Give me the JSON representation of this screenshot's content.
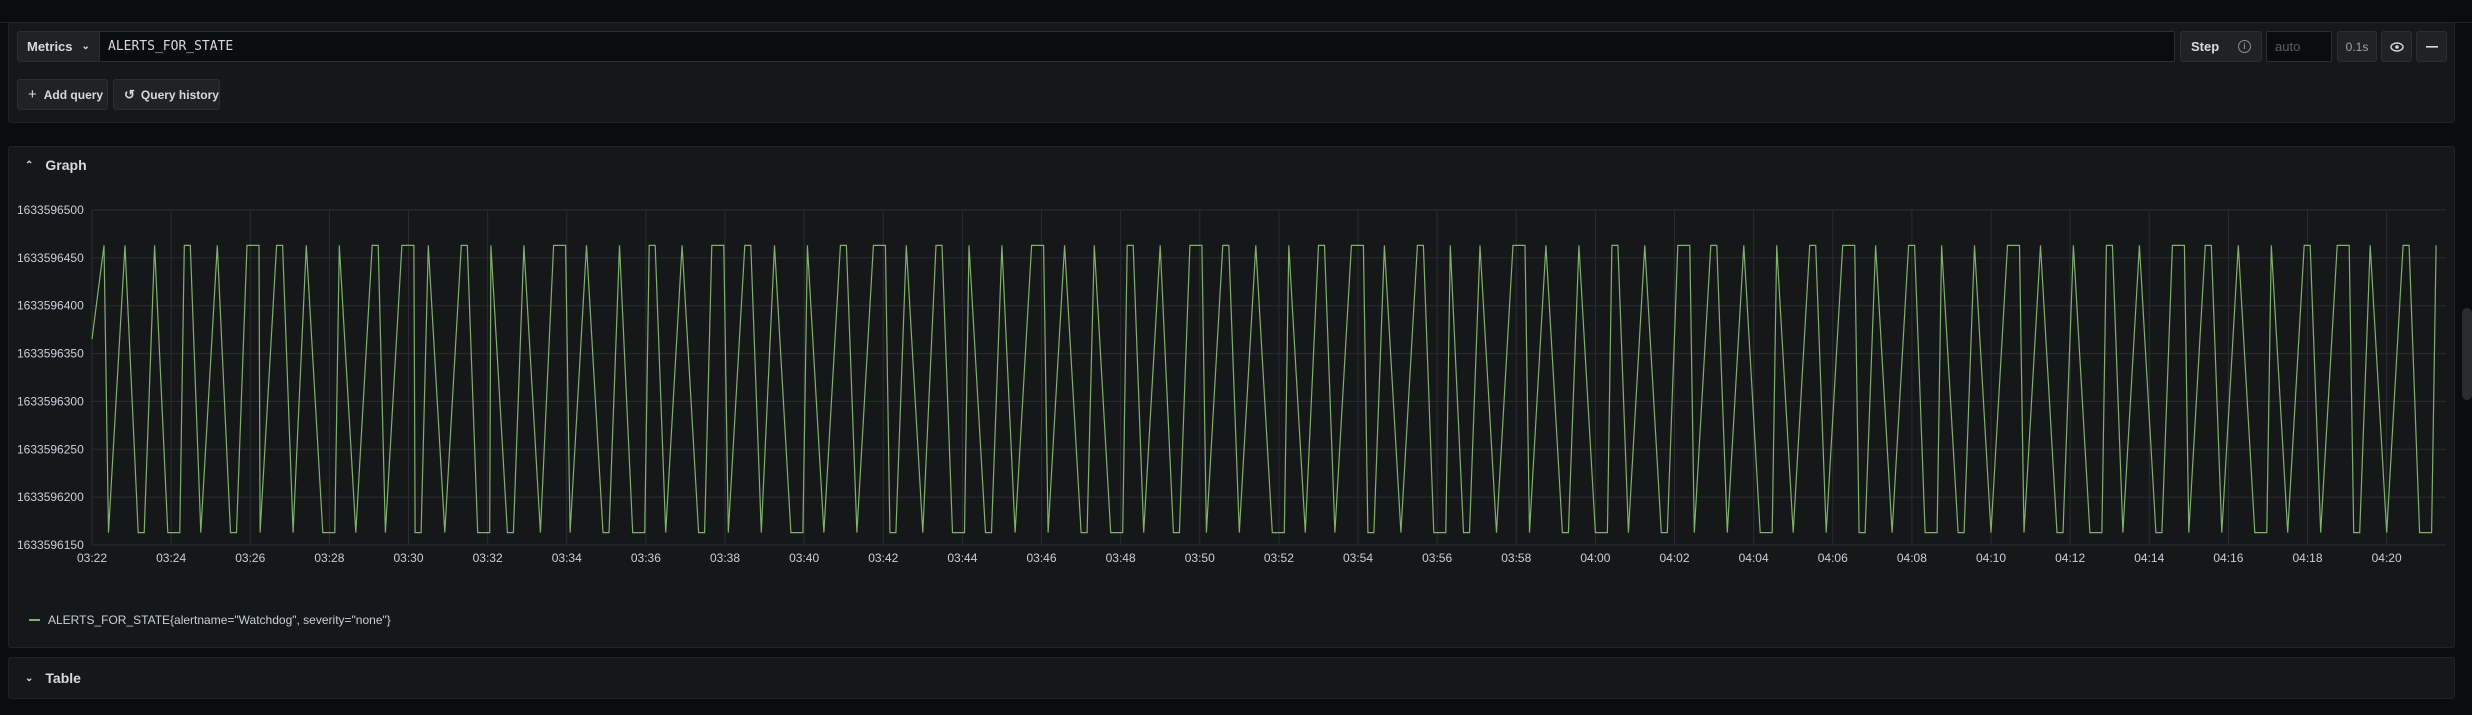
{
  "query_editor": {
    "metrics_label": "Metrics",
    "query_text": "ALERTS_FOR_STATE",
    "step_label": "Step",
    "step_placeholder": "auto",
    "query_time": "0.1s",
    "add_query_label": "Add query",
    "query_history_label": "Query history"
  },
  "graph_panel": {
    "title": "Graph",
    "legend_label": "ALERTS_FOR_STATE{alertname=\"Watchdog\", severity=\"none\"}"
  },
  "table_panel": {
    "title": "Table"
  },
  "colors": {
    "series": "#7eb26d",
    "grid": "#2a2c30",
    "panel_bg": "#161719"
  },
  "chart_data": {
    "type": "line",
    "x_tick_labels": [
      "03:22",
      "03:24",
      "03:26",
      "03:28",
      "03:30",
      "03:32",
      "03:34",
      "03:36",
      "03:38",
      "03:40",
      "03:42",
      "03:44",
      "03:46",
      "03:48",
      "03:50",
      "03:52",
      "03:54",
      "03:56",
      "03:58",
      "04:00",
      "04:02",
      "04:04",
      "04:06",
      "04:08",
      "04:10",
      "04:12",
      "04:14",
      "04:16",
      "04:18",
      "04:20"
    ],
    "x_range_minutes": [
      "03:22",
      "04:21:30"
    ],
    "y_ticks": [
      1633596150,
      1633596200,
      1633596250,
      1633596300,
      1633596350,
      1633596400,
      1633596450,
      1633596500
    ],
    "y_tick_labels": [
      "1633596150",
      "1633596200",
      "1633596250",
      "1633596300",
      "1633596350",
      "1633596400",
      "1633596450",
      "1633596500"
    ],
    "ylim": [
      1633596150,
      1633596500
    ],
    "grid": true,
    "legend_position": "bottom-left",
    "series": [
      {
        "name": "ALERTS_FOR_STATE{alertname=\"Watchdog\", severity=\"none\"}",
        "high": 1633596463,
        "low": 1633596163,
        "x": [
          "03:22",
          "03:22:25",
          "03:22:50",
          "03:23:10",
          "03:23:35",
          "03:23:55",
          "03:24:20",
          "03:24:45",
          "03:25:10",
          "03:25:30",
          "03:25:55",
          "03:26:15",
          "03:26:40",
          "03:27:05",
          "03:27:25",
          "03:27:50",
          "03:28:15",
          "03:28:40",
          "03:29:05",
          "03:29:25",
          "03:29:50",
          "03:30:10",
          "03:30:30",
          "03:30:55",
          "03:31:20",
          "03:31:45",
          "03:32:05",
          "03:32:30",
          "03:32:55",
          "03:33:20",
          "03:33:40",
          "03:34:05",
          "03:34:30",
          "03:34:55",
          "03:35:20",
          "03:35:40",
          "03:36:05",
          "03:36:30",
          "03:36:55",
          "03:37:20",
          "03:37:40",
          "03:38:05",
          "03:38:30",
          "03:38:55",
          "03:39:15",
          "03:39:40",
          "03:40:05",
          "03:40:30",
          "03:40:55",
          "03:41:20",
          "03:41:45",
          "03:42:10",
          "03:42:35",
          "03:43:00",
          "03:43:20",
          "03:43:45",
          "03:44:10",
          "03:44:35",
          "03:45:00",
          "03:45:20",
          "03:45:45",
          "03:46:10",
          "03:46:35",
          "03:47:00",
          "03:47:20",
          "03:47:45",
          "03:48:10",
          "03:48:35",
          "03:49:00",
          "03:49:20",
          "03:49:45",
          "03:50:10",
          "03:50:35",
          "03:51:00",
          "03:51:25",
          "03:51:50",
          "03:52:15",
          "03:52:40",
          "03:53:00",
          "03:53:25",
          "03:53:50",
          "03:54:15",
          "03:54:40",
          "03:55:05",
          "03:55:30",
          "03:55:55",
          "03:56:20",
          "03:56:40",
          "03:57:05",
          "03:57:30",
          "03:57:55",
          "03:58:20",
          "03:58:45",
          "03:59:10",
          "03:59:35",
          "04:00:00",
          "04:00:25",
          "04:00:50",
          "04:01:15",
          "04:01:40",
          "04:02:05",
          "04:02:30",
          "04:02:55",
          "04:03:20",
          "04:03:45",
          "04:04:10",
          "04:04:35",
          "04:05:00",
          "04:05:25",
          "04:05:50",
          "04:06:15",
          "04:06:40",
          "04:07:05",
          "04:07:30",
          "04:07:55",
          "04:08:20",
          "04:08:45",
          "04:09:10",
          "04:09:35",
          "04:10:00",
          "04:10:25",
          "04:10:50",
          "04:11:15",
          "04:11:40",
          "04:12:05",
          "04:12:30",
          "04:12:55",
          "04:13:20",
          "04:13:45",
          "04:14:10",
          "04:14:35",
          "04:15:00",
          "04:15:25",
          "04:15:50",
          "04:16:15",
          "04:16:40",
          "04:17:05",
          "04:17:30",
          "04:17:55",
          "04:18:20",
          "04:18:45",
          "04:19:10",
          "04:19:35",
          "04:20:00",
          "04:20:25",
          "04:20:50",
          "04:21:15"
        ],
        "pattern_note": ""
      }
    ]
  }
}
